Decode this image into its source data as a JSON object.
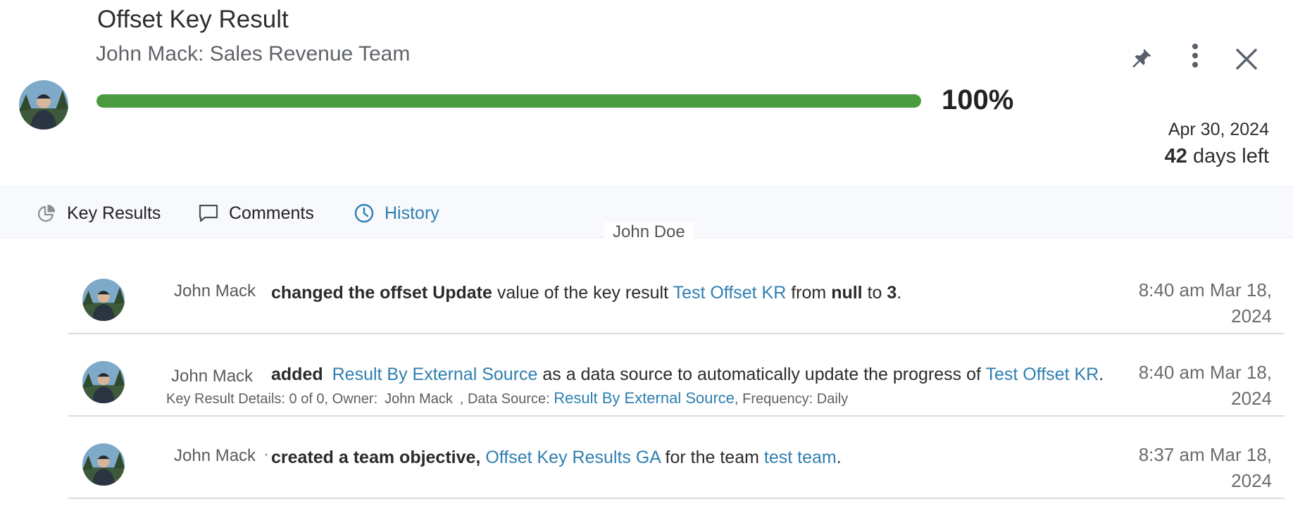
{
  "header": {
    "title": "Offset Key Result",
    "subtitle": "John Mack: Sales Revenue Team",
    "progress_value": 1.0,
    "progress_label": "100%",
    "due_date": "Apr 30, 2024",
    "days_left_count": "42",
    "days_left_suffix": " days left",
    "icons": {
      "pin": "pin-icon",
      "more": "more-vertical-icon",
      "close": "close-icon"
    },
    "colors": {
      "progress_fill": "#4a9a3f",
      "link": "#2f7fb0"
    }
  },
  "tabs": [
    {
      "label": "Key Results",
      "icon": "pie-chart-icon"
    },
    {
      "label": "Comments",
      "icon": "comment-icon"
    },
    {
      "label": "History",
      "icon": "clock-icon",
      "active": true
    }
  ],
  "history_header": "John Doe",
  "history": [
    {
      "actor": "John Mack",
      "action": "changed the offset Update",
      "t1": " value of the key result ",
      "link1": "Test Offset KR",
      "t2": " from ",
      "from": "null",
      "t3": " to ",
      "to": "3",
      "t4": ".",
      "time": "8:40 am Mar 18, 2024"
    },
    {
      "actor": "John Mack",
      "action": "added",
      "link1": "Result By External Source",
      "t1": " as a data source to automatically update the progress of ",
      "link2": "Test Offset KR",
      "t2": ".",
      "details_prefix": "Key Result Details: 0 of 0, Owner:",
      "details_owner": "John Mack",
      "details_source_label": ", Data Source:",
      "details_source": "Result By External Source",
      "details_freq": ", Frequency: Daily",
      "time": "8:40 am Mar 18, 2024"
    },
    {
      "actor": "John Mack",
      "sep": "·",
      "action": "created a team objective,",
      "link1": "Offset Key Results GA",
      "t1": " for the team ",
      "link2": "test team",
      "t2": ".",
      "time": "8:37 am Mar 18, 2024"
    }
  ]
}
